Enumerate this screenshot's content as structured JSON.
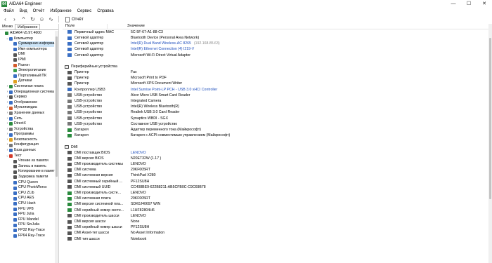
{
  "window": {
    "title": "AIDA64 Engineer",
    "minimize": "—",
    "maximize": "☐",
    "close": "✕"
  },
  "menu": [
    "Файл",
    "Вид",
    "Отчёт",
    "Избранное",
    "Сервис",
    "Справка"
  ],
  "toolbar": {
    "report_label": "Отчёт"
  },
  "sidebar": {
    "tabs": [
      "Меню",
      "Избранное"
    ],
    "nodes": [
      {
        "label": "AIDA64 v5.97.4600",
        "level": 0,
        "arrow": "",
        "color": "#2a8a3e"
      },
      {
        "label": "Компьютер",
        "level": 1,
        "arrow": "⌄",
        "color": "#3a6fc4"
      },
      {
        "label": "Суммарная информа",
        "level": 2,
        "arrow": "",
        "color": "#3a6fc4",
        "selected": true
      },
      {
        "label": "Имя компьютера",
        "level": 2,
        "arrow": "",
        "color": "#3a6fc4"
      },
      {
        "label": "DMI",
        "level": 2,
        "arrow": "",
        "color": "#555"
      },
      {
        "label": "IPMI",
        "level": 2,
        "arrow": "",
        "color": "#555"
      },
      {
        "label": "Разгон",
        "level": 2,
        "arrow": "",
        "color": "#d35a2a"
      },
      {
        "label": "Электропитание",
        "level": 2,
        "arrow": "",
        "color": "#3aa048"
      },
      {
        "label": "Портативный ПК",
        "level": 2,
        "arrow": "",
        "color": "#3a6fc4"
      },
      {
        "label": "Датчики",
        "level": 2,
        "arrow": "",
        "color": "#e0a020"
      },
      {
        "label": "Системная плата",
        "level": 1,
        "arrow": "›",
        "color": "#2a8a3e"
      },
      {
        "label": "Операционная система",
        "level": 1,
        "arrow": "›",
        "color": "#3a6fc4"
      },
      {
        "label": "Сервер",
        "level": 1,
        "arrow": "›",
        "color": "#555"
      },
      {
        "label": "Отображение",
        "level": 1,
        "arrow": "›",
        "color": "#3a6fc4"
      },
      {
        "label": "Мультимедиа",
        "level": 1,
        "arrow": "›",
        "color": "#d35a2a"
      },
      {
        "label": "Хранение данных",
        "level": 1,
        "arrow": "›",
        "color": "#777"
      },
      {
        "label": "Сеть",
        "level": 1,
        "arrow": "›",
        "color": "#3a6fc4"
      },
      {
        "label": "DirectX",
        "level": 1,
        "arrow": "›",
        "color": "#2a8a3e"
      },
      {
        "label": "Устройства",
        "level": 1,
        "arrow": "›",
        "color": "#777"
      },
      {
        "label": "Программы",
        "level": 1,
        "arrow": "›",
        "color": "#3a6fc4"
      },
      {
        "label": "Безопасность",
        "level": 1,
        "arrow": "›",
        "color": "#e0a020"
      },
      {
        "label": "Конфигурация",
        "level": 1,
        "arrow": "›",
        "color": "#777"
      },
      {
        "label": "База данных",
        "level": 1,
        "arrow": "›",
        "color": "#3a6fc4"
      },
      {
        "label": "Тест",
        "level": 1,
        "arrow": "⌄",
        "color": "#d33a2a"
      },
      {
        "label": "Чтение из памяти",
        "level": 2,
        "arrow": "",
        "color": "#555"
      },
      {
        "label": "Запись в память",
        "level": 2,
        "arrow": "",
        "color": "#555"
      },
      {
        "label": "Копирование в памят",
        "level": 2,
        "arrow": "",
        "color": "#555"
      },
      {
        "label": "Задержка памяти",
        "level": 2,
        "arrow": "",
        "color": "#555"
      },
      {
        "label": "CPU Queen",
        "level": 2,
        "arrow": "",
        "color": "#3a6fc4"
      },
      {
        "label": "CPU PhotoWorxx",
        "level": 2,
        "arrow": "",
        "color": "#3a6fc4"
      },
      {
        "label": "CPU ZLib",
        "level": 2,
        "arrow": "",
        "color": "#3a6fc4"
      },
      {
        "label": "CPU AES",
        "level": 2,
        "arrow": "",
        "color": "#3a6fc4"
      },
      {
        "label": "CPU Hash",
        "level": 2,
        "arrow": "",
        "color": "#3a6fc4"
      },
      {
        "label": "FPU VP8",
        "level": 2,
        "arrow": "",
        "color": "#3a6fc4"
      },
      {
        "label": "FPU Julia",
        "level": 2,
        "arrow": "",
        "color": "#3a6fc4"
      },
      {
        "label": "FPU Mandel",
        "level": 2,
        "arrow": "",
        "color": "#3a6fc4"
      },
      {
        "label": "FPU SinJulia",
        "level": 2,
        "arrow": "",
        "color": "#3a6fc4"
      },
      {
        "label": "FP32 Ray-Trace",
        "level": 2,
        "arrow": "",
        "color": "#3a6fc4"
      },
      {
        "label": "FP64 Ray-Trace",
        "level": 2,
        "arrow": "",
        "color": "#3a6fc4"
      }
    ]
  },
  "columns": {
    "field": "Поле",
    "value": "Значение"
  },
  "rows": [
    {
      "kind": "row",
      "icon": "#3a6fc4",
      "field": "Первичный адрес MAC",
      "value": "5C-5F-67-A1-88-C3"
    },
    {
      "kind": "row",
      "icon": "#3a6fc4",
      "field": "Сетевой адаптер",
      "value": "Bluetooth Device (Personal Area Network)"
    },
    {
      "kind": "row",
      "icon": "#3a6fc4",
      "field": "Сетевой адаптер",
      "value": "Intel(R) Dual Band Wireless-AC 8265",
      "extra": "(192.168.85.63)",
      "link": true
    },
    {
      "kind": "row",
      "icon": "#3a6fc4",
      "field": "Сетевой адаптер",
      "value": "Intel(R) Ethernet Connection (4) I219-V",
      "link": true
    },
    {
      "kind": "row",
      "icon": "#3a6fc4",
      "field": "Сетевой адаптер",
      "value": "Microsoft Wi-Fi Direct Virtual Adapter"
    },
    {
      "kind": "gap"
    },
    {
      "kind": "section",
      "label": "Периферийные устройства"
    },
    {
      "kind": "row",
      "icon": "#555",
      "field": "Принтер",
      "value": "Fax"
    },
    {
      "kind": "row",
      "icon": "#555",
      "field": "Принтер",
      "value": "Microsoft Print to PDF"
    },
    {
      "kind": "row",
      "icon": "#555",
      "field": "Принтер",
      "value": "Microsoft XPS Document Writer"
    },
    {
      "kind": "row",
      "icon": "#3a6fc4",
      "field": "Контроллер USB3",
      "value": "Intel Sunrise Point-LP PCH - USB 3.0 xHCI Controller",
      "link": true
    },
    {
      "kind": "row",
      "icon": "#777",
      "field": "USB-устройство",
      "value": "Alcor Micro USB Smart Card Reader"
    },
    {
      "kind": "row",
      "icon": "#777",
      "field": "USB-устройство",
      "value": "Integrated Camera"
    },
    {
      "kind": "row",
      "icon": "#777",
      "field": "USB-устройство",
      "value": "Intel(R) Wireless Bluetooth(R)"
    },
    {
      "kind": "row",
      "icon": "#777",
      "field": "USB-устройство",
      "value": "Realtek USB 3.0 Card Reader"
    },
    {
      "kind": "row",
      "icon": "#777",
      "field": "USB-устройство",
      "value": "Synaptics WBDI - SGX"
    },
    {
      "kind": "row",
      "icon": "#777",
      "field": "USB-устройство",
      "value": "Составное USB устройство"
    },
    {
      "kind": "row",
      "icon": "#2a8a3e",
      "field": "Батарея",
      "value": "Адаптер переменного тока (Майкрософт)"
    },
    {
      "kind": "row",
      "icon": "#2a8a3e",
      "field": "Батарея",
      "value": "Батарея с ACPI-совместимым управлением (Майкрософт)"
    },
    {
      "kind": "gap"
    },
    {
      "kind": "section",
      "label": "DMI"
    },
    {
      "kind": "row",
      "icon": "#555",
      "field": "DMI поставщик BIOS",
      "value": "LENOVO",
      "link": true
    },
    {
      "kind": "row",
      "icon": "#555",
      "field": "DMI версия BIOS",
      "value": "N20ET32W (1.17 )"
    },
    {
      "kind": "row",
      "icon": "#555",
      "field": "DMI производитель системы",
      "value": "LENOVO"
    },
    {
      "kind": "row",
      "icon": "#555",
      "field": "DMI система",
      "value": "20KF005RT"
    },
    {
      "kind": "row",
      "icon": "#555",
      "field": "DMI системная версия",
      "value": "ThinkPad X280"
    },
    {
      "kind": "row",
      "icon": "#555",
      "field": "DMI системный серийный ...",
      "value": "PF12SU8H"
    },
    {
      "kind": "row",
      "icon": "#555",
      "field": "DMI системный UUID",
      "value": "CC408BE9-622B8211-AB5CFB0C-C9C69B78"
    },
    {
      "kind": "row",
      "icon": "#2a8a3e",
      "field": "DMI производитель систе...",
      "value": "LENOVO"
    },
    {
      "kind": "row",
      "icon": "#2a8a3e",
      "field": "DMI системная плата",
      "value": "20KF005RT"
    },
    {
      "kind": "row",
      "icon": "#2a8a3e",
      "field": "DMI версия системной пла...",
      "value": "SDK0J40697 WIN"
    },
    {
      "kind": "row",
      "icon": "#2a8a3e",
      "field": "DMI серийный номер систе...",
      "value": "L1HF82804H6"
    },
    {
      "kind": "row",
      "icon": "#555",
      "field": "DMI производитель шасси",
      "value": "LENOVO"
    },
    {
      "kind": "row",
      "icon": "#555",
      "field": "DMI версия шасси",
      "value": "None"
    },
    {
      "kind": "row",
      "icon": "#555",
      "field": "DMI серийный номер шасси",
      "value": "PF12SU8H"
    },
    {
      "kind": "row",
      "icon": "#555",
      "field": "DMI Asset-тег шасси",
      "value": "No Asset Information"
    },
    {
      "kind": "row",
      "icon": "#555",
      "field": "DMI тип шасси",
      "value": "Notebook"
    }
  ]
}
